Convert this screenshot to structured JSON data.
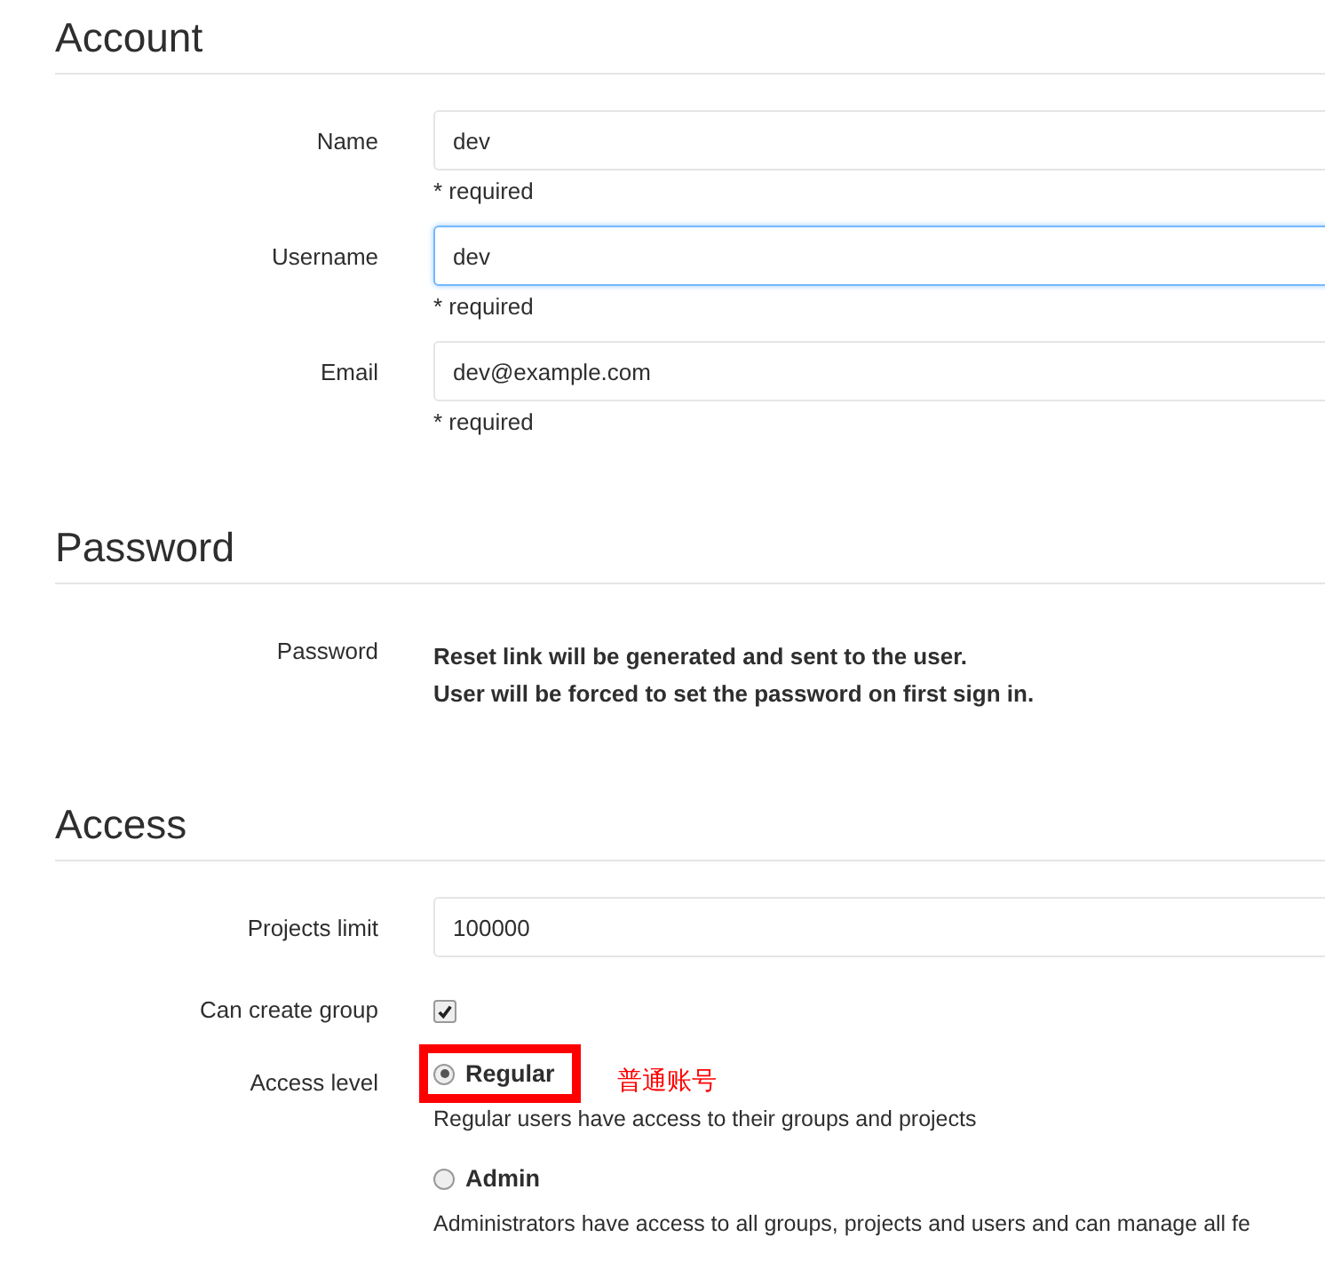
{
  "sections": [
    {
      "title": "Account",
      "fields": [
        {
          "kind": "text",
          "label": "Name",
          "value": "dev",
          "focused": false,
          "hint": "* required"
        },
        {
          "kind": "text",
          "label": "Username",
          "value": "dev",
          "focused": true,
          "hint": "* required"
        },
        {
          "kind": "text",
          "label": "Email",
          "value": "dev@example.com",
          "focused": false,
          "hint": "* required"
        }
      ]
    },
    {
      "title": "Password",
      "fields": [
        {
          "kind": "note",
          "label": "Password",
          "lines": [
            "Reset link will be generated and sent to the user.",
            "User will be forced to set the password on first sign in."
          ]
        }
      ]
    },
    {
      "title": "Access",
      "fields": [
        {
          "kind": "text",
          "label": "Projects limit",
          "value": "100000",
          "focused": false
        },
        {
          "kind": "checkbox",
          "label": "Can create group",
          "checked": true
        },
        {
          "kind": "radio",
          "label": "Access level",
          "annotation": "普通账号",
          "options": [
            {
              "label": "Regular",
              "selected": true,
              "highlighted": true,
              "description": "Regular users have access to their groups and projects"
            },
            {
              "label": "Admin",
              "selected": false,
              "highlighted": false,
              "description": "Administrators have access to all groups, projects and users and can manage all fe"
            }
          ]
        }
      ]
    }
  ]
}
